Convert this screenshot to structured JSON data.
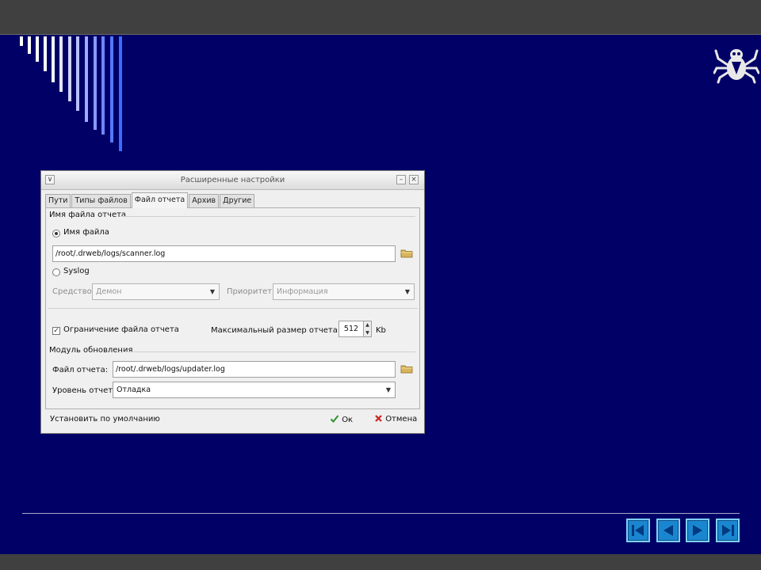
{
  "dialog": {
    "title": "Расширенные настройки",
    "menu_glyph": "∨",
    "min_glyph": "–",
    "close_glyph": "×",
    "tabs": [
      {
        "label": "Пути"
      },
      {
        "label": "Типы файлов"
      },
      {
        "label": "Файл отчета"
      },
      {
        "label": "Архив"
      },
      {
        "label": "Другие"
      }
    ],
    "active_tab": "Файл отчета",
    "report_group": {
      "title": "Имя файла отчета",
      "file_name_radio": "Имя файла",
      "file_name_value": "/root/.drweb/logs/scanner.log",
      "syslog_radio": "Syslog",
      "facility_label": "Средство:",
      "facility_value": "Демон",
      "priority_label": "Приоритет:",
      "priority_value": "Информация"
    },
    "limit": {
      "checkbox_label": "Ограничение файла отчета",
      "check_glyph": "✓",
      "max_size_label": "Максимальный размер отчета:",
      "max_size_value": "512",
      "unit": "Kb"
    },
    "update_group": {
      "title": "Модуль обновления",
      "report_file_label": "Файл отчета:",
      "report_file_value": "/root/.drweb/logs/updater.log",
      "level_label": "Уровень отчета:",
      "level_value": "Отладка"
    },
    "footer": {
      "defaults_label": "Установить по умолчанию",
      "ok_label": "Ок",
      "cancel_label": "Отмена"
    }
  },
  "colors": {
    "background": "#000066",
    "bar": "#404040",
    "nav_button": "#1a86d0"
  },
  "icons": [
    "drweb-spider-logo",
    "folder-icon",
    "ok-check-icon",
    "cancel-x-icon",
    "first-page-icon",
    "previous-page-icon",
    "next-page-icon",
    "last-page-icon"
  ]
}
